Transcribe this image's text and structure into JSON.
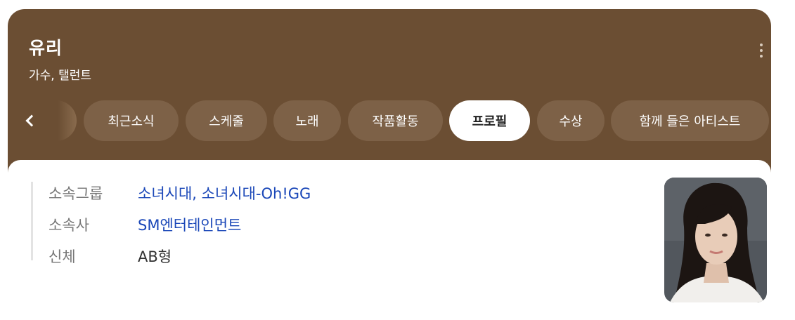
{
  "header": {
    "title": "유리",
    "subtitle": "가수, 탤런트"
  },
  "tabs": [
    {
      "label": "최근소식"
    },
    {
      "label": "스케줄"
    },
    {
      "label": "노래"
    },
    {
      "label": "작품활동"
    },
    {
      "label": "프로필",
      "active": true
    },
    {
      "label": "수상"
    },
    {
      "label": "함께 들은 아티스트"
    }
  ],
  "profile": {
    "rows": [
      {
        "label": "소속그룹",
        "value": "소녀시대, 소녀시대-Oh!GG"
      },
      {
        "label": "소속사",
        "value": "SM엔터테인먼트"
      },
      {
        "label": "신체",
        "value": "AB형"
      }
    ]
  },
  "icons": {
    "more": "more-vertical-icon",
    "prev": "chevron-left-icon"
  },
  "colors": {
    "header_bg": "#6b4e33",
    "tab_bg": "#7d6147",
    "link": "#1a47b8"
  }
}
